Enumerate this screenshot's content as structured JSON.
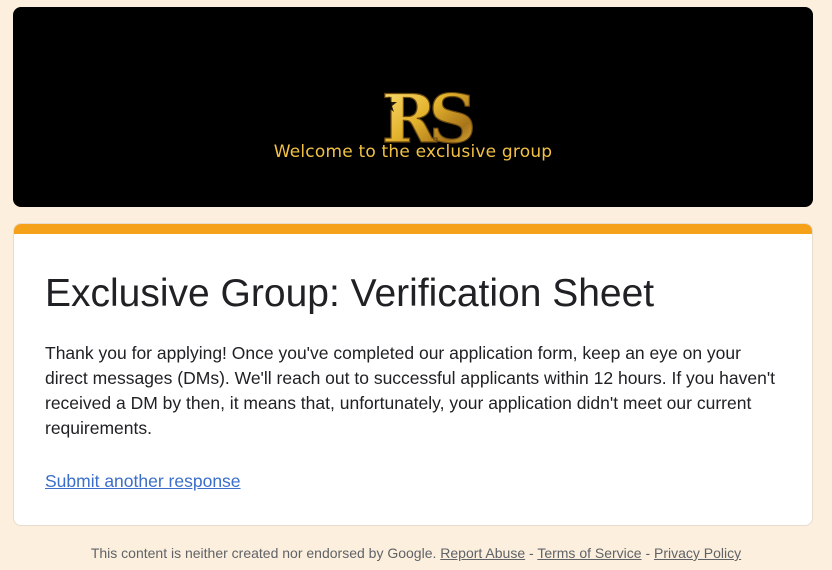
{
  "banner": {
    "logo_text": "RS",
    "tagline": "Welcome to the exclusive group",
    "logo_color": "#e3b22c",
    "background": "#000000"
  },
  "form": {
    "accent_color": "#f6a11a",
    "title": "Exclusive Group: Verification Sheet",
    "message": "Thank you for applying! Once you've completed our application form, keep an eye on your direct messages (DMs). We'll reach out to successful applicants within 12 hours. If you haven't received a DM by then, it means that, unfortunately, your application didn't meet our current requirements.",
    "submit_another_label": "Submit another response"
  },
  "footer": {
    "disclaimer": "This content is neither created nor endorsed by Google.",
    "separator": " - ",
    "report_abuse": "Report Abuse",
    "terms": "Terms of Service",
    "privacy": "Privacy Policy"
  },
  "page_background": "#fcefdd"
}
